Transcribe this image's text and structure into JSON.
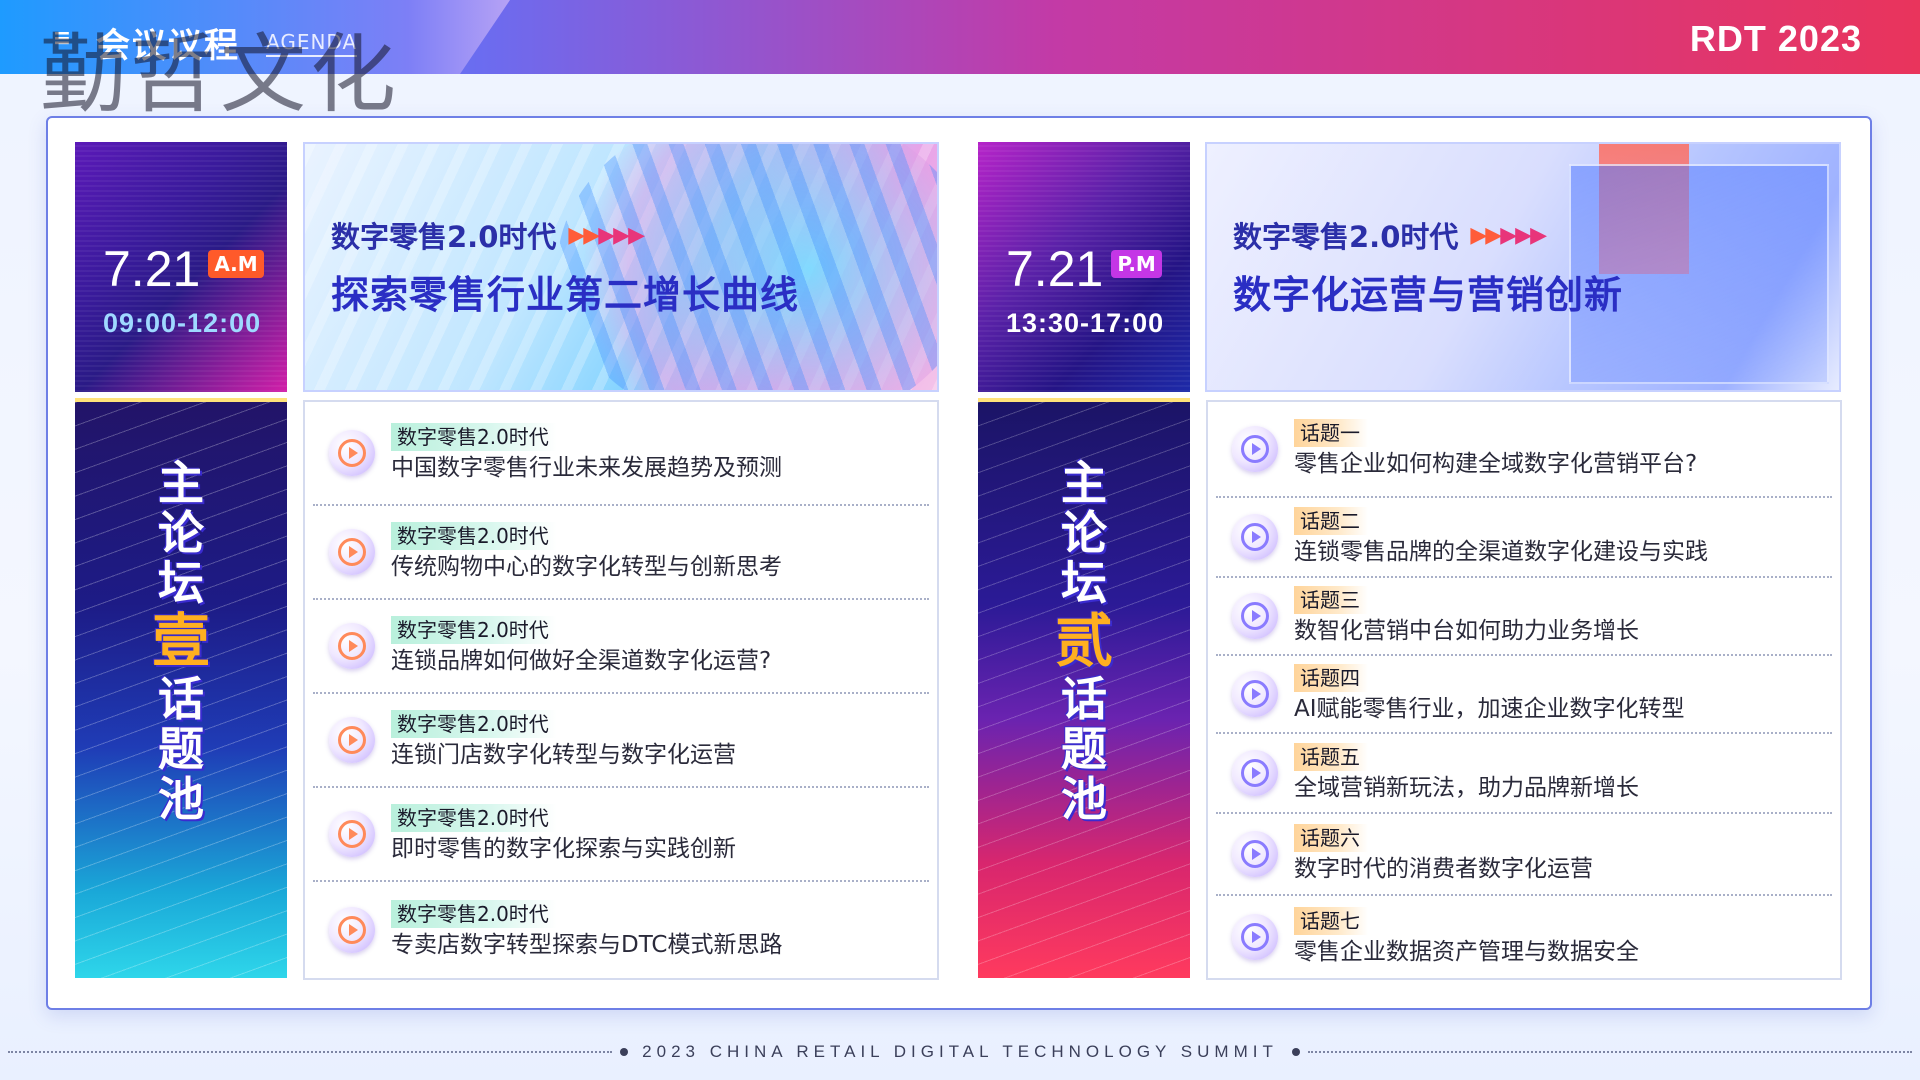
{
  "header": {
    "logo_glyph": "≡",
    "title": "会议议程",
    "subtitle": "AGENDA",
    "watermark": "勤哲文化",
    "event": "RDT 2023"
  },
  "colors": {
    "accent_blue": "#2a2ec4",
    "am_tag": "#ff5a2a",
    "pm_tag": "#c436e6",
    "forum_accent": "#ffb020"
  },
  "morning": {
    "date": "7.21",
    "period": "A.M",
    "time": "09:00-12:00",
    "banner_kicker": "数字零售2.0时代",
    "banner_title": "探索零售行业第二增长曲线",
    "forum_chars": [
      "主",
      "论",
      "坛",
      "壹",
      "话",
      "题",
      "池"
    ],
    "topics": [
      {
        "tag": "数字零售2.0时代",
        "desc": "中国数字零售行业未来发展趋势及预测"
      },
      {
        "tag": "数字零售2.0时代",
        "desc": "传统购物中心的数字化转型与创新思考"
      },
      {
        "tag": "数字零售2.0时代",
        "desc": "连锁品牌如何做好全渠道数字化运营?"
      },
      {
        "tag": "数字零售2.0时代",
        "desc": "连锁门店数字化转型与数字化运营"
      },
      {
        "tag": "数字零售2.0时代",
        "desc": "即时零售的数字化探索与实践创新"
      },
      {
        "tag": "数字零售2.0时代",
        "desc": "专卖店数字转型探索与DTC模式新思路"
      }
    ]
  },
  "afternoon": {
    "date": "7.21",
    "period": "P.M",
    "time": "13:30-17:00",
    "banner_kicker": "数字零售2.0时代",
    "banner_title": "数字化运营与营销创新",
    "forum_chars": [
      "主",
      "论",
      "坛",
      "贰",
      "话",
      "题",
      "池"
    ],
    "topics": [
      {
        "tag": "话题一",
        "desc": "零售企业如何构建全域数字化营销平台?"
      },
      {
        "tag": "话题二",
        "desc": "连锁零售品牌的全渠道数字化建设与实践"
      },
      {
        "tag": "话题三",
        "desc": "数智化营销中台如何助力业务增长"
      },
      {
        "tag": "话题四",
        "desc": "AI赋能零售行业，加速企业数字化转型"
      },
      {
        "tag": "话题五",
        "desc": "全域营销新玩法，助力品牌新增长"
      },
      {
        "tag": "话题六",
        "desc": "数字时代的消费者数字化运营"
      },
      {
        "tag": "话题七",
        "desc": "零售企业数据资产管理与数据安全"
      }
    ]
  },
  "footer": {
    "text": "2023 CHINA RETAIL DIGITAL TECHNOLOGY SUMMIT"
  }
}
